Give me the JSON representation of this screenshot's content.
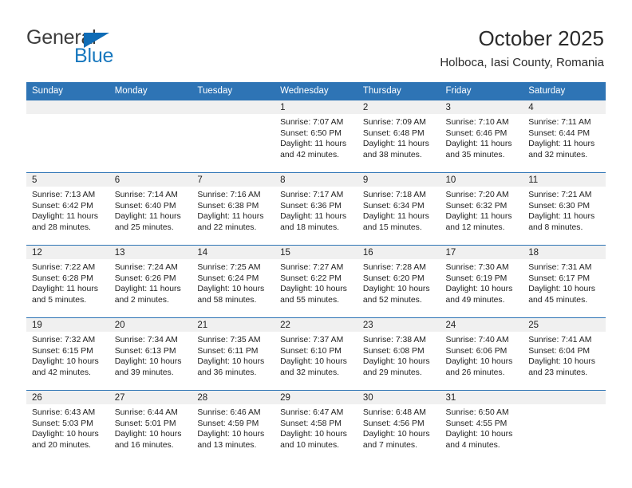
{
  "brand": {
    "name_part1": "General",
    "name_part2": "Blue",
    "triangle_color": "#0f6cb6",
    "blue_text_color": "#1878be"
  },
  "header": {
    "title": "October 2025",
    "subtitle": "Holboca, Iasi County, Romania",
    "header_bg": "#2e74b5",
    "band_bg": "#f0f0f0"
  },
  "weekday_headers": [
    "Sunday",
    "Monday",
    "Tuesday",
    "Wednesday",
    "Thursday",
    "Friday",
    "Saturday"
  ],
  "weeks": [
    [
      {
        "day": "",
        "sunrise": "",
        "sunset": "",
        "daylight1": "",
        "daylight2": "",
        "empty": true
      },
      {
        "day": "",
        "sunrise": "",
        "sunset": "",
        "daylight1": "",
        "daylight2": "",
        "empty": true
      },
      {
        "day": "",
        "sunrise": "",
        "sunset": "",
        "daylight1": "",
        "daylight2": "",
        "empty": true
      },
      {
        "day": "1",
        "sunrise": "Sunrise: 7:07 AM",
        "sunset": "Sunset: 6:50 PM",
        "daylight1": "Daylight: 11 hours",
        "daylight2": "and 42 minutes."
      },
      {
        "day": "2",
        "sunrise": "Sunrise: 7:09 AM",
        "sunset": "Sunset: 6:48 PM",
        "daylight1": "Daylight: 11 hours",
        "daylight2": "and 38 minutes."
      },
      {
        "day": "3",
        "sunrise": "Sunrise: 7:10 AM",
        "sunset": "Sunset: 6:46 PM",
        "daylight1": "Daylight: 11 hours",
        "daylight2": "and 35 minutes."
      },
      {
        "day": "4",
        "sunrise": "Sunrise: 7:11 AM",
        "sunset": "Sunset: 6:44 PM",
        "daylight1": "Daylight: 11 hours",
        "daylight2": "and 32 minutes."
      }
    ],
    [
      {
        "day": "5",
        "sunrise": "Sunrise: 7:13 AM",
        "sunset": "Sunset: 6:42 PM",
        "daylight1": "Daylight: 11 hours",
        "daylight2": "and 28 minutes."
      },
      {
        "day": "6",
        "sunrise": "Sunrise: 7:14 AM",
        "sunset": "Sunset: 6:40 PM",
        "daylight1": "Daylight: 11 hours",
        "daylight2": "and 25 minutes."
      },
      {
        "day": "7",
        "sunrise": "Sunrise: 7:16 AM",
        "sunset": "Sunset: 6:38 PM",
        "daylight1": "Daylight: 11 hours",
        "daylight2": "and 22 minutes."
      },
      {
        "day": "8",
        "sunrise": "Sunrise: 7:17 AM",
        "sunset": "Sunset: 6:36 PM",
        "daylight1": "Daylight: 11 hours",
        "daylight2": "and 18 minutes."
      },
      {
        "day": "9",
        "sunrise": "Sunrise: 7:18 AM",
        "sunset": "Sunset: 6:34 PM",
        "daylight1": "Daylight: 11 hours",
        "daylight2": "and 15 minutes."
      },
      {
        "day": "10",
        "sunrise": "Sunrise: 7:20 AM",
        "sunset": "Sunset: 6:32 PM",
        "daylight1": "Daylight: 11 hours",
        "daylight2": "and 12 minutes."
      },
      {
        "day": "11",
        "sunrise": "Sunrise: 7:21 AM",
        "sunset": "Sunset: 6:30 PM",
        "daylight1": "Daylight: 11 hours",
        "daylight2": "and 8 minutes."
      }
    ],
    [
      {
        "day": "12",
        "sunrise": "Sunrise: 7:22 AM",
        "sunset": "Sunset: 6:28 PM",
        "daylight1": "Daylight: 11 hours",
        "daylight2": "and 5 minutes."
      },
      {
        "day": "13",
        "sunrise": "Sunrise: 7:24 AM",
        "sunset": "Sunset: 6:26 PM",
        "daylight1": "Daylight: 11 hours",
        "daylight2": "and 2 minutes."
      },
      {
        "day": "14",
        "sunrise": "Sunrise: 7:25 AM",
        "sunset": "Sunset: 6:24 PM",
        "daylight1": "Daylight: 10 hours",
        "daylight2": "and 58 minutes."
      },
      {
        "day": "15",
        "sunrise": "Sunrise: 7:27 AM",
        "sunset": "Sunset: 6:22 PM",
        "daylight1": "Daylight: 10 hours",
        "daylight2": "and 55 minutes."
      },
      {
        "day": "16",
        "sunrise": "Sunrise: 7:28 AM",
        "sunset": "Sunset: 6:20 PM",
        "daylight1": "Daylight: 10 hours",
        "daylight2": "and 52 minutes."
      },
      {
        "day": "17",
        "sunrise": "Sunrise: 7:30 AM",
        "sunset": "Sunset: 6:19 PM",
        "daylight1": "Daylight: 10 hours",
        "daylight2": "and 49 minutes."
      },
      {
        "day": "18",
        "sunrise": "Sunrise: 7:31 AM",
        "sunset": "Sunset: 6:17 PM",
        "daylight1": "Daylight: 10 hours",
        "daylight2": "and 45 minutes."
      }
    ],
    [
      {
        "day": "19",
        "sunrise": "Sunrise: 7:32 AM",
        "sunset": "Sunset: 6:15 PM",
        "daylight1": "Daylight: 10 hours",
        "daylight2": "and 42 minutes."
      },
      {
        "day": "20",
        "sunrise": "Sunrise: 7:34 AM",
        "sunset": "Sunset: 6:13 PM",
        "daylight1": "Daylight: 10 hours",
        "daylight2": "and 39 minutes."
      },
      {
        "day": "21",
        "sunrise": "Sunrise: 7:35 AM",
        "sunset": "Sunset: 6:11 PM",
        "daylight1": "Daylight: 10 hours",
        "daylight2": "and 36 minutes."
      },
      {
        "day": "22",
        "sunrise": "Sunrise: 7:37 AM",
        "sunset": "Sunset: 6:10 PM",
        "daylight1": "Daylight: 10 hours",
        "daylight2": "and 32 minutes."
      },
      {
        "day": "23",
        "sunrise": "Sunrise: 7:38 AM",
        "sunset": "Sunset: 6:08 PM",
        "daylight1": "Daylight: 10 hours",
        "daylight2": "and 29 minutes."
      },
      {
        "day": "24",
        "sunrise": "Sunrise: 7:40 AM",
        "sunset": "Sunset: 6:06 PM",
        "daylight1": "Daylight: 10 hours",
        "daylight2": "and 26 minutes."
      },
      {
        "day": "25",
        "sunrise": "Sunrise: 7:41 AM",
        "sunset": "Sunset: 6:04 PM",
        "daylight1": "Daylight: 10 hours",
        "daylight2": "and 23 minutes."
      }
    ],
    [
      {
        "day": "26",
        "sunrise": "Sunrise: 6:43 AM",
        "sunset": "Sunset: 5:03 PM",
        "daylight1": "Daylight: 10 hours",
        "daylight2": "and 20 minutes."
      },
      {
        "day": "27",
        "sunrise": "Sunrise: 6:44 AM",
        "sunset": "Sunset: 5:01 PM",
        "daylight1": "Daylight: 10 hours",
        "daylight2": "and 16 minutes."
      },
      {
        "day": "28",
        "sunrise": "Sunrise: 6:46 AM",
        "sunset": "Sunset: 4:59 PM",
        "daylight1": "Daylight: 10 hours",
        "daylight2": "and 13 minutes."
      },
      {
        "day": "29",
        "sunrise": "Sunrise: 6:47 AM",
        "sunset": "Sunset: 4:58 PM",
        "daylight1": "Daylight: 10 hours",
        "daylight2": "and 10 minutes."
      },
      {
        "day": "30",
        "sunrise": "Sunrise: 6:48 AM",
        "sunset": "Sunset: 4:56 PM",
        "daylight1": "Daylight: 10 hours",
        "daylight2": "and 7 minutes."
      },
      {
        "day": "31",
        "sunrise": "Sunrise: 6:50 AM",
        "sunset": "Sunset: 4:55 PM",
        "daylight1": "Daylight: 10 hours",
        "daylight2": "and 4 minutes."
      },
      {
        "day": "",
        "sunrise": "",
        "sunset": "",
        "daylight1": "",
        "daylight2": "",
        "empty": true
      }
    ]
  ]
}
